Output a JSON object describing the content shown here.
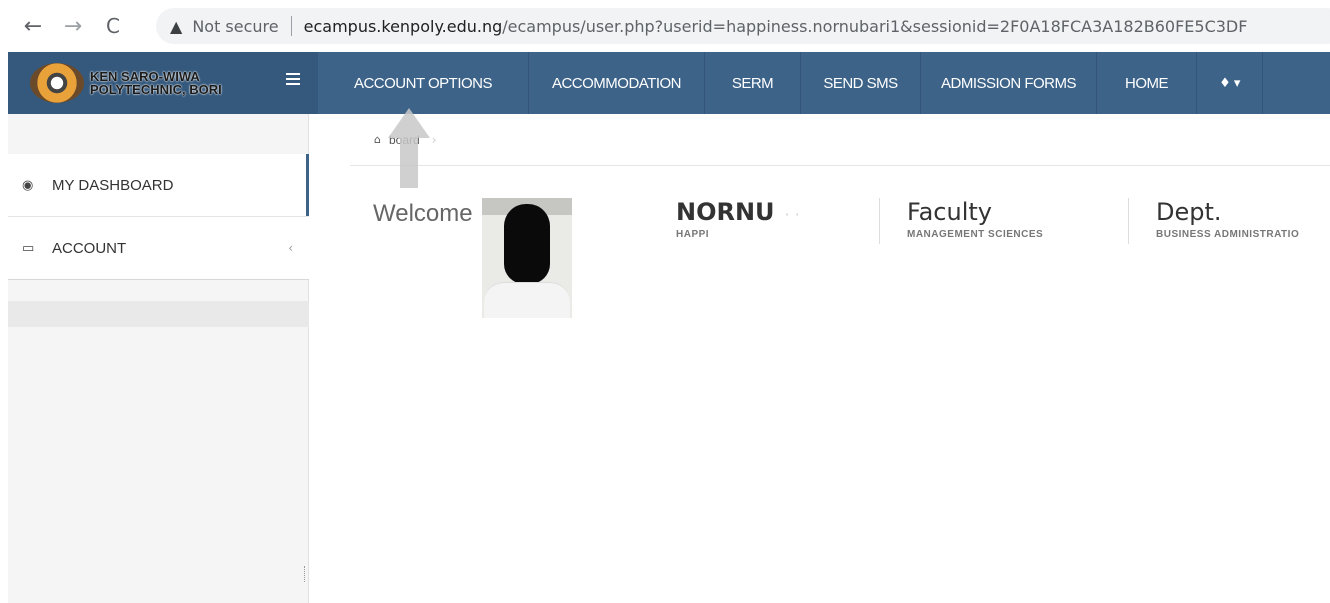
{
  "browser": {
    "back_icon": "←",
    "forward_icon": "→",
    "reload_icon": "C",
    "warning_icon": "▲",
    "security_label": "Not secure",
    "url_host": "ecampus.kenpoly.edu.ng",
    "url_path": "/ecampus/user.php?userid=happiness.nornubari1&sessionid=2F0A18FCA3A182B60FE5C3DF"
  },
  "header": {
    "brand_line1": "KEN SARO-WIWA",
    "brand_line2": "POLYTECHNIC, BORI",
    "nav": [
      {
        "label": "ACCOUNT OPTIONS"
      },
      {
        "label": "ACCOMMODATION"
      },
      {
        "label": "SERM"
      },
      {
        "label": "SEND SMS"
      },
      {
        "label": "ADMISSION FORMS"
      },
      {
        "label": "HOME"
      },
      {
        "label": "♦ ▾"
      }
    ]
  },
  "sidebar": {
    "items": [
      {
        "label": "MY DASHBOARD",
        "icon": "dashboard-icon"
      },
      {
        "label": "ACCOUNT",
        "icon": "monitor-icon"
      }
    ],
    "chevron": "‹"
  },
  "breadcrumb": {
    "label": "board",
    "separator": "›"
  },
  "main": {
    "welcome": "Welcome",
    "name_title": "NORNU",
    "name_sub": "HAPPI",
    "faculty_title": "Faculty",
    "faculty_sub": "MANAGEMENT SCIENCES",
    "dept_title": "Dept.",
    "dept_sub": "BUSINESS ADMINISTRATIO"
  },
  "colors": {
    "header": "#3d6389",
    "brand": "#35597d",
    "sidebar_accent": "#3d6389"
  }
}
